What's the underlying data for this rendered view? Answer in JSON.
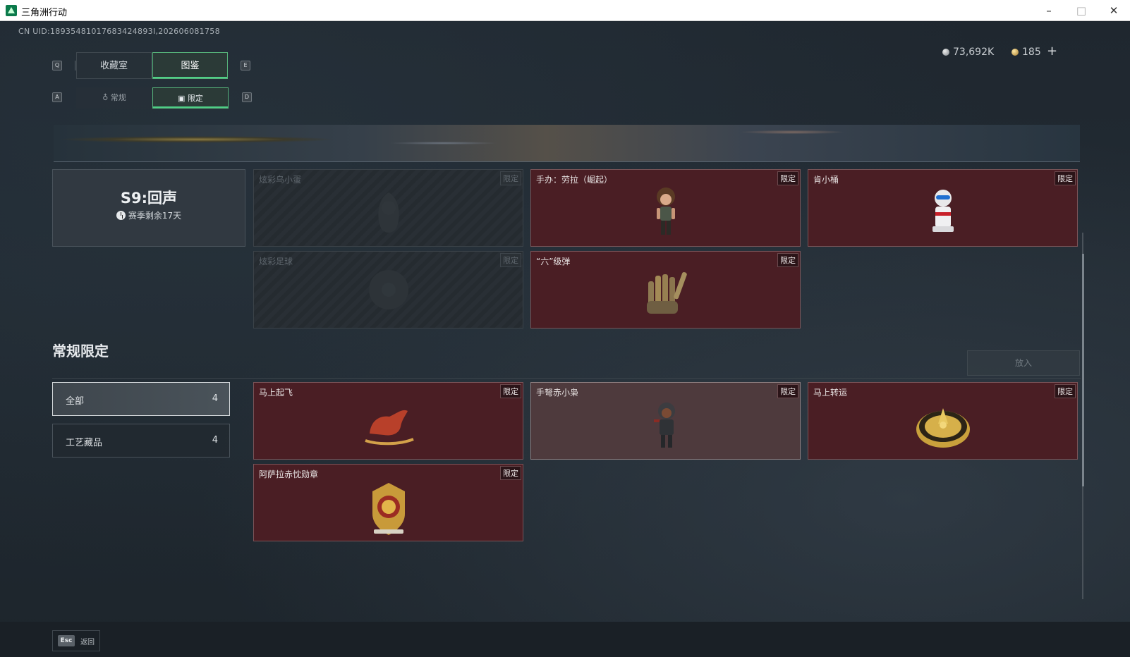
{
  "window": {
    "title": "三角洲行动",
    "min": "–",
    "max": "□",
    "close": "✕"
  },
  "uid": "CN UID:18935481017683424893I,202606081758",
  "currency": {
    "silver": "73,692K",
    "gold": "185",
    "plus": "+"
  },
  "keys": {
    "q": "Q",
    "e": "E",
    "a": "A",
    "d": "D"
  },
  "tabs": [
    {
      "label": "收藏室"
    },
    {
      "label": "图鉴"
    }
  ],
  "subtabs": [
    {
      "label": "常规"
    },
    {
      "label": "限定"
    }
  ],
  "season": {
    "name": "S9:回声",
    "remaining": "赛季剩余17天"
  },
  "season_items": [
    {
      "name": "炫彩乌小蛋",
      "tag": "限定",
      "locked": true
    },
    {
      "name": "手办：劳拉（崛起）",
      "tag": "限定",
      "locked": false
    },
    {
      "name": "肯小桶",
      "tag": "限定",
      "locked": false
    },
    {
      "name": "炫彩足球",
      "tag": "限定",
      "locked": true
    },
    {
      "name": "“六”级弹",
      "tag": "限定",
      "locked": false
    }
  ],
  "regular_section": {
    "title": "常规限定",
    "put_button": "放入",
    "filters": [
      {
        "label": "全部",
        "count": "4"
      },
      {
        "label": "工艺藏品",
        "count": "4"
      }
    ],
    "items": [
      {
        "name": "马上起飞",
        "tag": "限定"
      },
      {
        "name": "手弩赤小枭",
        "tag": "限定"
      },
      {
        "name": "马上转运",
        "tag": "限定"
      },
      {
        "name": "阿萨拉赤忱勋章",
        "tag": "限定"
      }
    ]
  },
  "footer": {
    "esc_key": "Esc",
    "back_label": "返回"
  }
}
